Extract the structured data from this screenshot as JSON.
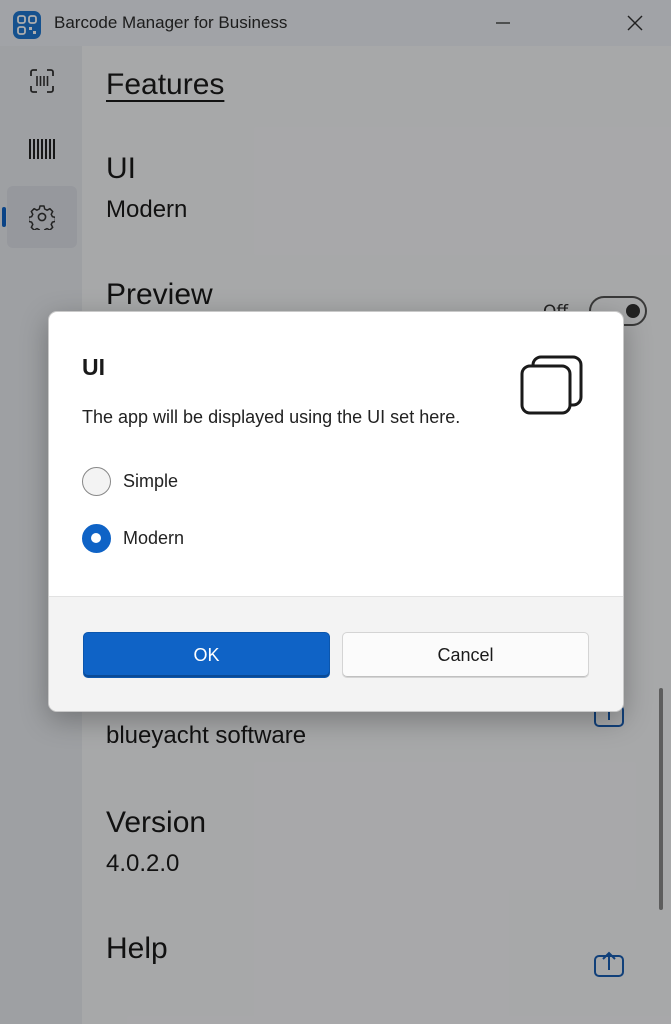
{
  "window": {
    "title": "Barcode Manager for Business"
  },
  "nav": {
    "items": [
      {
        "icon": "scan-qr-icon"
      },
      {
        "icon": "barcode-icon"
      },
      {
        "icon": "gear-icon",
        "active": true
      }
    ]
  },
  "settings": {
    "features_title": "Features",
    "ui_title": "UI",
    "ui_value": "Modern",
    "preview_title": "Preview",
    "preview_toggle_label": "Off",
    "company_value": "blueyacht software",
    "version_title": "Version",
    "version_value": "4.0.2.0",
    "help_title": "Help"
  },
  "dialog": {
    "title": "UI",
    "description": "The app will be displayed using the UI set here.",
    "options": [
      {
        "label": "Simple",
        "selected": false
      },
      {
        "label": "Modern",
        "selected": true
      }
    ],
    "ok_label": "OK",
    "cancel_label": "Cancel"
  },
  "colors": {
    "accent": "#0f63c6",
    "overlay": "rgba(0,0,0,0.32)"
  }
}
